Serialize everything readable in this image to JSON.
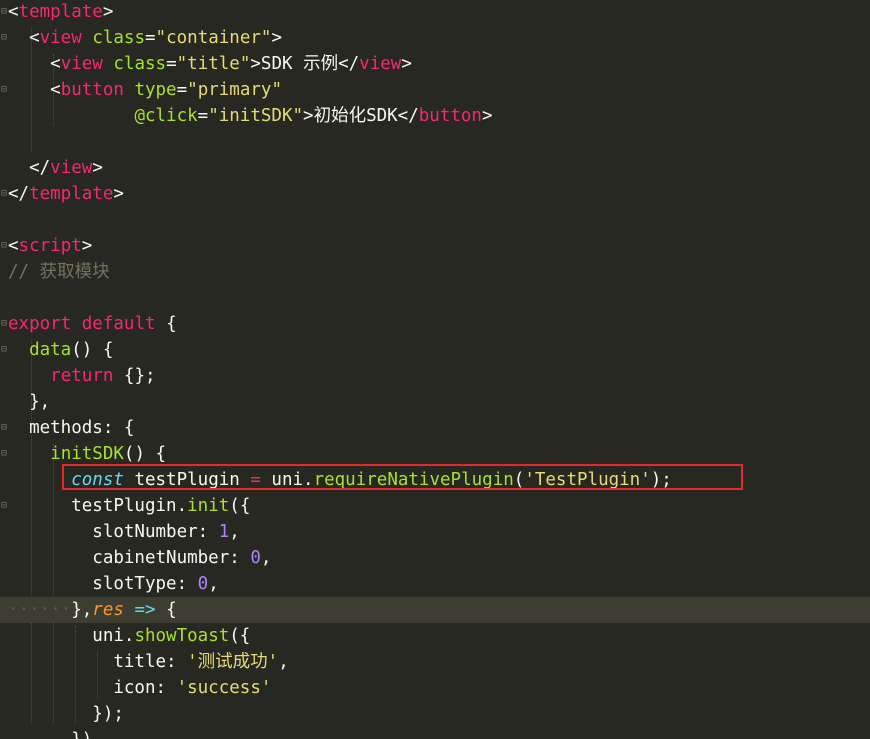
{
  "editor": {
    "theme_colors": {
      "background": "#272822",
      "tag": "#f92672",
      "attribute": "#a6e22e",
      "string": "#e6db74",
      "number": "#ae81ff",
      "comment": "#75715e",
      "highlight_box": "#e8262d"
    },
    "lines": [
      {
        "segments": [
          {
            "t": "<",
            "c": "punc"
          },
          {
            "t": "template",
            "c": "tag"
          },
          {
            "t": ">",
            "c": "punc"
          }
        ]
      },
      {
        "segments": [
          {
            "t": "  <",
            "c": "punc"
          },
          {
            "t": "view",
            "c": "tag"
          },
          {
            "t": " ",
            "c": "punc"
          },
          {
            "t": "class",
            "c": "attr"
          },
          {
            "t": "=",
            "c": "punc"
          },
          {
            "t": "\"container\"",
            "c": "str"
          },
          {
            "t": ">",
            "c": "punc"
          }
        ]
      },
      {
        "segments": [
          {
            "t": "    <",
            "c": "punc"
          },
          {
            "t": "view",
            "c": "tag"
          },
          {
            "t": " ",
            "c": "punc"
          },
          {
            "t": "class",
            "c": "attr"
          },
          {
            "t": "=",
            "c": "punc"
          },
          {
            "t": "\"title\"",
            "c": "str"
          },
          {
            "t": ">SDK 示例</",
            "c": "punc"
          },
          {
            "t": "view",
            "c": "tag"
          },
          {
            "t": ">",
            "c": "punc"
          }
        ]
      },
      {
        "segments": [
          {
            "t": "    <",
            "c": "punc"
          },
          {
            "t": "button",
            "c": "tag"
          },
          {
            "t": " ",
            "c": "punc"
          },
          {
            "t": "type",
            "c": "attr"
          },
          {
            "t": "=",
            "c": "punc"
          },
          {
            "t": "\"primary\"",
            "c": "str"
          }
        ]
      },
      {
        "segments": [
          {
            "t": "            ",
            "c": "punc"
          },
          {
            "t": "@click",
            "c": "attr"
          },
          {
            "t": "=",
            "c": "punc"
          },
          {
            "t": "\"initSDK\"",
            "c": "str"
          },
          {
            "t": ">初始化SDK</",
            "c": "punc"
          },
          {
            "t": "button",
            "c": "tag"
          },
          {
            "t": ">",
            "c": "punc"
          }
        ]
      },
      {
        "segments": []
      },
      {
        "segments": [
          {
            "t": "  </",
            "c": "punc"
          },
          {
            "t": "view",
            "c": "tag"
          },
          {
            "t": ">",
            "c": "punc"
          }
        ]
      },
      {
        "segments": [
          {
            "t": "</",
            "c": "punc"
          },
          {
            "t": "template",
            "c": "tag"
          },
          {
            "t": ">",
            "c": "punc"
          }
        ]
      },
      {
        "segments": []
      },
      {
        "segments": [
          {
            "t": "<",
            "c": "punc"
          },
          {
            "t": "script",
            "c": "tag"
          },
          {
            "t": ">",
            "c": "punc"
          }
        ]
      },
      {
        "segments": [
          {
            "t": "// 获取模块",
            "c": "com"
          }
        ]
      },
      {
        "segments": []
      },
      {
        "segments": [
          {
            "t": "export",
            "c": "kw"
          },
          {
            "t": " ",
            "c": "punc"
          },
          {
            "t": "default",
            "c": "kw"
          },
          {
            "t": " {",
            "c": "punc"
          }
        ]
      },
      {
        "segments": [
          {
            "t": "  ",
            "c": "punc"
          },
          {
            "t": "data",
            "c": "fn"
          },
          {
            "t": "() {",
            "c": "punc"
          }
        ]
      },
      {
        "segments": [
          {
            "t": "    ",
            "c": "punc"
          },
          {
            "t": "return",
            "c": "kw"
          },
          {
            "t": " {};",
            "c": "punc"
          }
        ]
      },
      {
        "segments": [
          {
            "t": "  },",
            "c": "punc"
          }
        ]
      },
      {
        "segments": [
          {
            "t": "  methods: {",
            "c": "punc"
          }
        ]
      },
      {
        "segments": [
          {
            "t": "    ",
            "c": "punc"
          },
          {
            "t": "initSDK",
            "c": "fn"
          },
          {
            "t": "() {",
            "c": "punc"
          }
        ]
      },
      {
        "segments": [
          {
            "t": "      ",
            "c": "punc"
          },
          {
            "t": "const",
            "c": "const"
          },
          {
            "t": " testPlugin ",
            "c": "punc"
          },
          {
            "t": "=",
            "c": "kw"
          },
          {
            "t": " uni.",
            "c": "punc"
          },
          {
            "t": "requireNativePlugin",
            "c": "fn"
          },
          {
            "t": "(",
            "c": "punc"
          },
          {
            "t": "'TestPlugin'",
            "c": "str"
          },
          {
            "t": ");",
            "c": "punc"
          }
        ]
      },
      {
        "segments": [
          {
            "t": "      testPlugin.",
            "c": "punc"
          },
          {
            "t": "init",
            "c": "fn"
          },
          {
            "t": "({",
            "c": "punc"
          }
        ]
      },
      {
        "segments": [
          {
            "t": "        slotNumber: ",
            "c": "punc"
          },
          {
            "t": "1",
            "c": "num"
          },
          {
            "t": ",",
            "c": "punc"
          }
        ]
      },
      {
        "segments": [
          {
            "t": "        cabinetNumber: ",
            "c": "punc"
          },
          {
            "t": "0",
            "c": "num"
          },
          {
            "t": ",",
            "c": "punc"
          }
        ]
      },
      {
        "segments": [
          {
            "t": "        slotType: ",
            "c": "punc"
          },
          {
            "t": "0",
            "c": "num"
          },
          {
            "t": ",",
            "c": "punc"
          }
        ]
      },
      {
        "segments": [
          {
            "t": "······",
            "c": "dots"
          },
          {
            "t": "},",
            "c": "punc"
          },
          {
            "t": "res",
            "c": "param"
          },
          {
            "t": " ",
            "c": "punc"
          },
          {
            "t": "=>",
            "c": "const"
          },
          {
            "t": " {",
            "c": "punc"
          }
        ]
      },
      {
        "segments": [
          {
            "t": "        uni.",
            "c": "punc"
          },
          {
            "t": "showToast",
            "c": "fn"
          },
          {
            "t": "({",
            "c": "punc"
          }
        ]
      },
      {
        "segments": [
          {
            "t": "          title: ",
            "c": "punc"
          },
          {
            "t": "'测试成功'",
            "c": "str"
          },
          {
            "t": ",",
            "c": "punc"
          }
        ]
      },
      {
        "segments": [
          {
            "t": "          icon: ",
            "c": "punc"
          },
          {
            "t": "'success'",
            "c": "str"
          }
        ]
      },
      {
        "segments": [
          {
            "t": "        });",
            "c": "punc"
          }
        ]
      },
      {
        "segments": [
          {
            "t": "      })",
            "c": "punc"
          }
        ]
      }
    ],
    "fold_markers": [
      0,
      1,
      3,
      7,
      9,
      12,
      13,
      16,
      17,
      19
    ]
  }
}
